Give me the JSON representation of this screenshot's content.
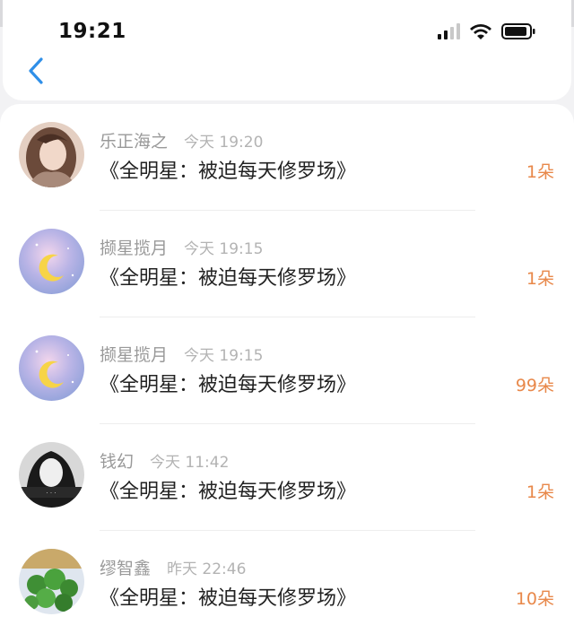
{
  "status_bar": {
    "time": "19:21",
    "icons": [
      "cellular-signal-icon",
      "wifi-icon",
      "battery-icon"
    ]
  },
  "nav": {
    "back_icon": "chevron-left-icon",
    "accent": "#2f8fe8"
  },
  "colors": {
    "count_color": "#e8884a",
    "name_color": "#999999",
    "title_color": "#222222"
  },
  "items": [
    {
      "name": "乐正海之",
      "time": "今天 19:20",
      "title": "《全明星：被迫每天修罗场》",
      "count": "1朵",
      "avatar": "portrait-girl-avatar"
    },
    {
      "name": "撷星揽月",
      "time": "今天 19:15",
      "title": "《全明星：被迫每天修罗场》",
      "count": "1朵",
      "avatar": "moon-galaxy-avatar"
    },
    {
      "name": "撷星揽月",
      "time": "今天 19:15",
      "title": "《全明星：被迫每天修罗场》",
      "count": "99朵",
      "avatar": "moon-galaxy-avatar"
    },
    {
      "name": "钱幻",
      "time": "今天 11:42",
      "title": "《全明星：被迫每天修罗场》",
      "count": "1朵",
      "avatar": "bw-portrait-avatar"
    },
    {
      "name": "缪智鑫",
      "time": "昨天 22:46",
      "title": "《全明星：被迫每天修罗场》",
      "count": "10朵",
      "avatar": "plant-avatar"
    }
  ]
}
